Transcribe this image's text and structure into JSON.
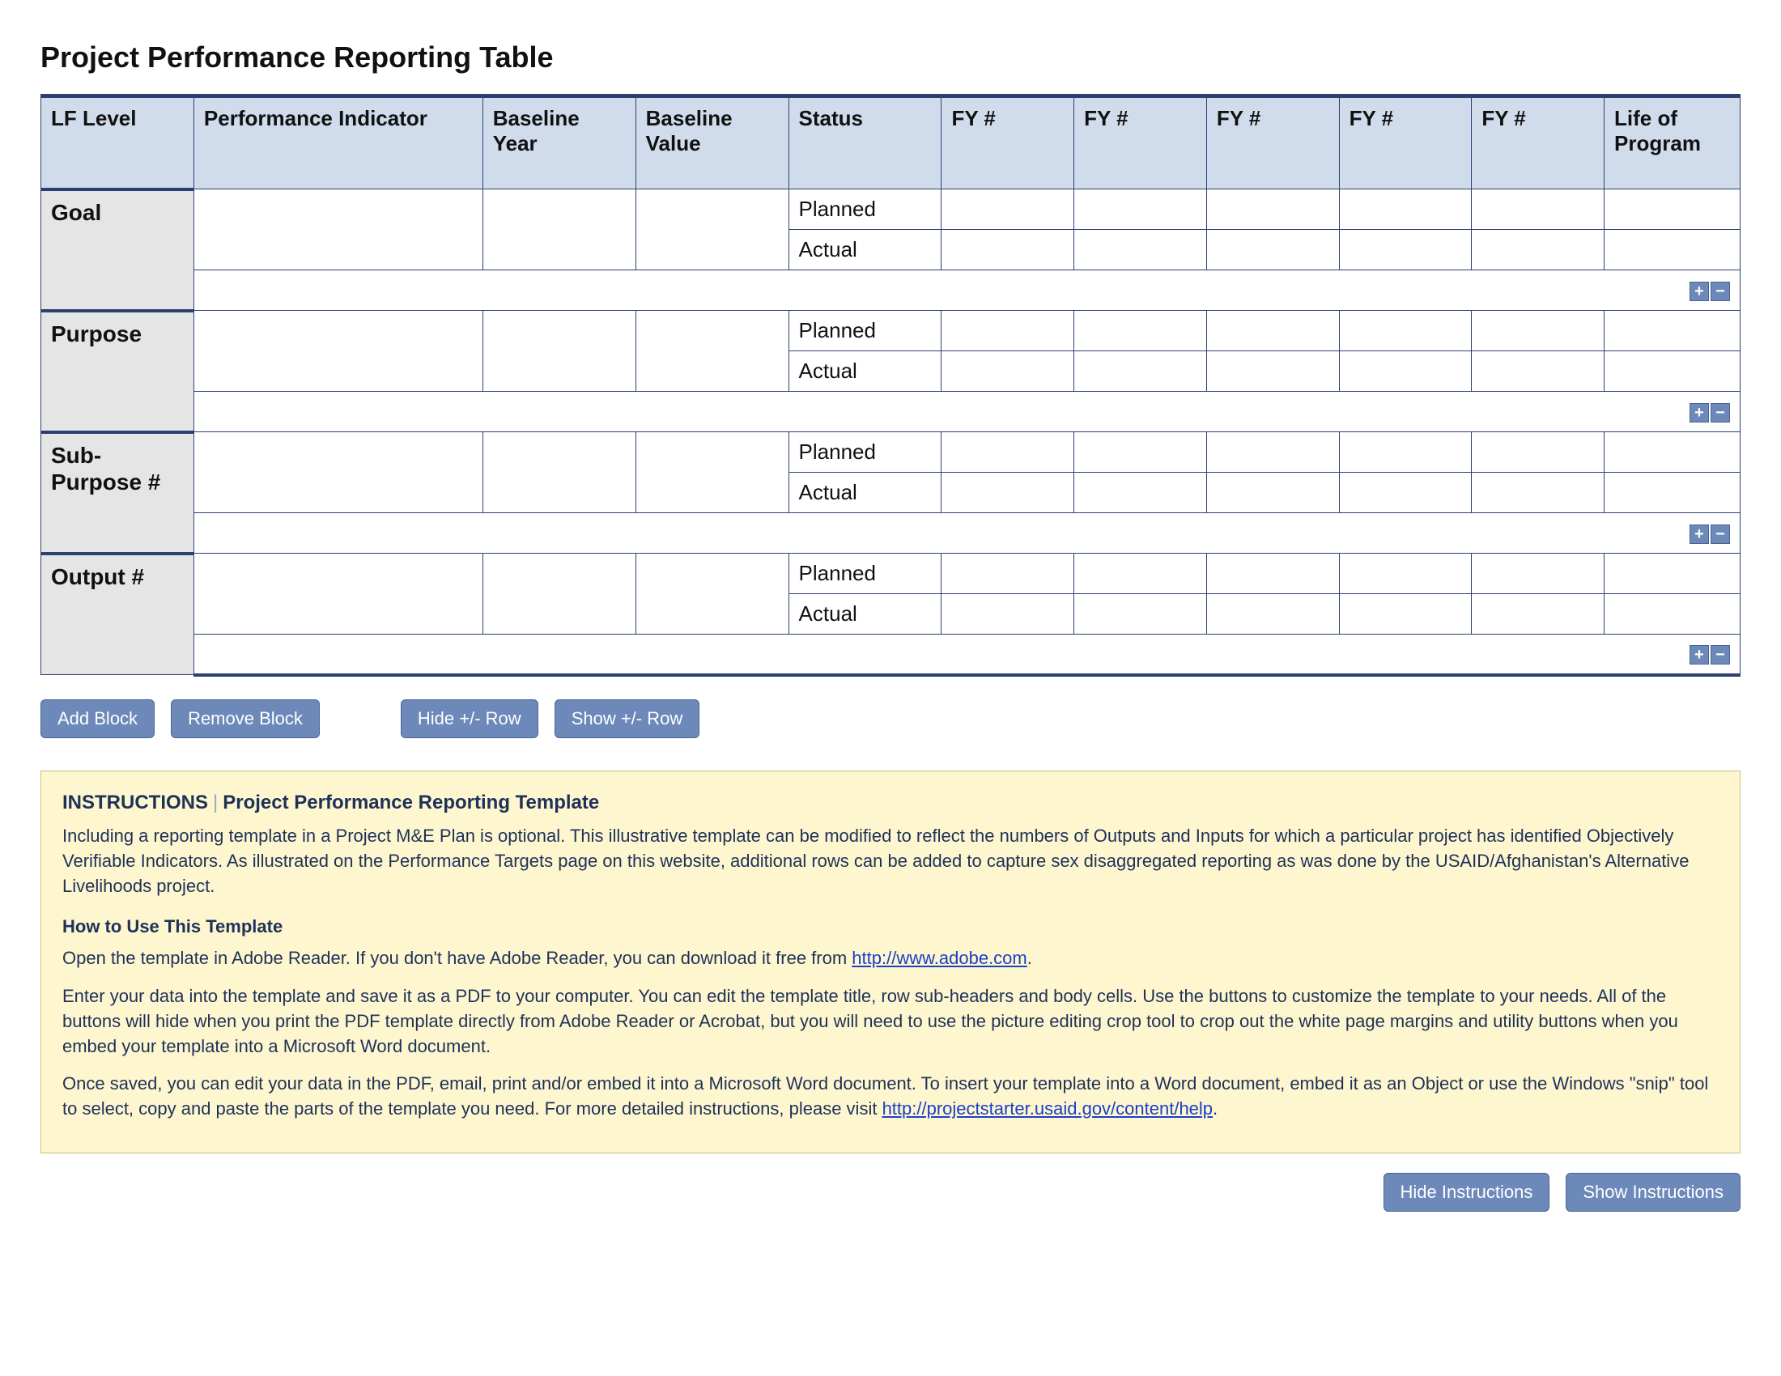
{
  "title": "Project Performance Reporting Table",
  "headers": {
    "lf": "LF Level",
    "pi": "Performance Indicator",
    "by": "Baseline Year",
    "bv": "Baseline Value",
    "status": "Status",
    "fy1": "FY #",
    "fy2": "FY #",
    "fy3": "FY #",
    "fy4": "FY #",
    "fy5": "FY #",
    "lop": "Life of Program"
  },
  "rows": {
    "goal": {
      "label": "Goal",
      "planned": "Planned",
      "actual": "Actual"
    },
    "purpose": {
      "label": "Purpose",
      "planned": "Planned",
      "actual": "Actual"
    },
    "subpurpose": {
      "label": "Sub-Purpose #",
      "planned": "Planned",
      "actual": "Actual"
    },
    "output": {
      "label": "Output #",
      "planned": "Planned",
      "actual": "Actual"
    }
  },
  "pm": {
    "plus": "+",
    "minus": "−"
  },
  "buttons": {
    "add_block": "Add Block",
    "remove_block": "Remove Block",
    "hide_row": "Hide +/- Row",
    "show_row": "Show +/- Row",
    "hide_instr": "Hide Instructions",
    "show_instr": "Show Instructions"
  },
  "instructions": {
    "header_label": "INSTRUCTIONS",
    "header_title": "Project Performance Reporting Template",
    "p1": "Including a reporting template in a Project M&E Plan is optional. This illustrative template can be modified to reflect the numbers of Outputs and Inputs for which a particular project has identified Objectively Verifiable Indicators. As illustrated on the Performance Targets page on this website, additional rows can be added to capture sex disaggregated reporting as was done by the USAID/Afghanistan's Alternative Livelihoods project.",
    "sub1": "How to Use This Template",
    "p2a": "Open the template in Adobe Reader. If you don't have Adobe Reader, you can download it free from ",
    "link1": "http://www.adobe.com",
    "p2b": ".",
    "p3": "Enter your data into the template and save it as a PDF to your computer. You can edit the template title, row sub-headers and body cells. Use the buttons to customize the template to your needs. All of the buttons will hide when you print the PDF template directly from Adobe Reader or Acrobat, but you will need to use the picture editing crop tool to crop out the white page margins and utility buttons when you embed your template into a Microsoft Word document.",
    "p4a": "Once saved, you can edit your data in the PDF, email, print and/or embed it into a Microsoft Word document. To insert your template into a Word document, embed it as an Object or use the Windows \"snip\" tool to select, copy and paste the parts of the template you need. For more detailed instructions, please visit ",
    "link2": "http://projectstarter.usaid.gov/content/help",
    "p4b": "."
  }
}
